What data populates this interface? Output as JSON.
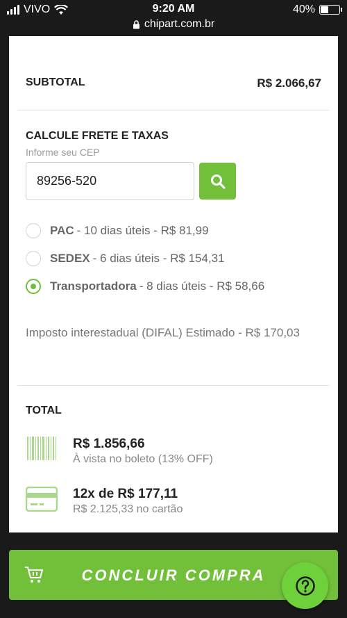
{
  "status_bar": {
    "carrier": "VIVO",
    "time": "9:20 AM",
    "battery": "40%",
    "battery_level": 0.4,
    "url": "chipart.com.br"
  },
  "subtotal": {
    "label": "SUBTOTAL",
    "value": "R$ 2.066,67"
  },
  "frete": {
    "title": "CALCULE FRETE E TAXAS",
    "hint": "Informe seu CEP",
    "cep_value": "89256-520",
    "options": [
      {
        "name": "PAC",
        "detail": "- 10 dias úteis - R$ 81,99",
        "selected": false
      },
      {
        "name": "SEDEX",
        "detail": "- 6 dias úteis - R$ 154,31",
        "selected": false
      },
      {
        "name": "Transportadora",
        "detail": "- 8 dias úteis - R$ 58,66",
        "selected": true
      }
    ],
    "imposto": "Imposto interestadual (DIFAL) Estimado - R$ 170,03"
  },
  "total": {
    "title": "TOTAL",
    "boleto": {
      "value": "R$ 1.856,66",
      "sub": "À vista no boleto (13% OFF)",
      "icon": "barcode-icon"
    },
    "cartao": {
      "value": "12x de R$ 177,11",
      "sub": "R$ 2.125,33 no cartão",
      "icon": "credit-card-icon"
    }
  },
  "actions": {
    "buy_label": "CONCLUIR COMPRA",
    "help_icon": "question-icon"
  },
  "colors": {
    "accent": "#72c03a",
    "background": "#1a1a1a"
  }
}
